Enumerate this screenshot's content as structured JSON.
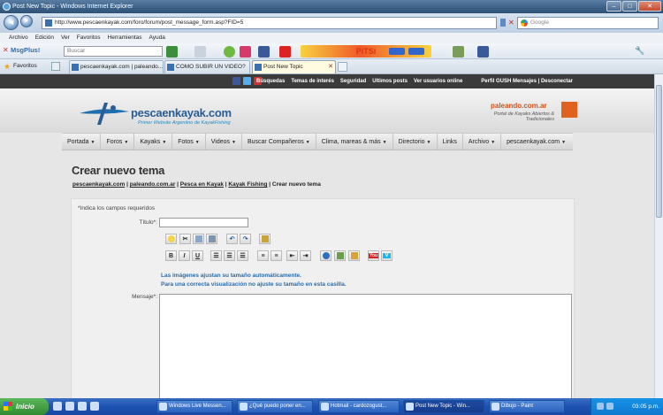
{
  "window": {
    "title": "Post New Topic - Windows Internet Explorer",
    "buttons": {
      "minimize": "–",
      "maximize": "□",
      "close": "✕"
    }
  },
  "browser": {
    "url": "http://www.pescaenkayak.com/foro/forum/post_message_form.asp?FID=5",
    "search_placeholder": "Google",
    "menu": [
      "Archivo",
      "Edición",
      "Ver",
      "Favoritos",
      "Herramientas",
      "Ayuda"
    ],
    "toolbar": {
      "msgplus_label": "MsgPlus!",
      "buscar_placeholder": "Buscar",
      "pitsi_label": "PiTSi"
    },
    "favorites_label": "Favoritos",
    "tabs": [
      {
        "label": "pescaenkayak.com | paleando...",
        "active": false
      },
      {
        "label": "COMO SUBIR UN VIDEO?",
        "active": false
      },
      {
        "label": "Post New Topic",
        "active": true
      }
    ]
  },
  "site": {
    "top_links": [
      "Búsquedas",
      "Temas de interés",
      "Seguridad",
      "Ultimos posts",
      "Ver usuarios online"
    ],
    "user_links": "Perfil GUSH  Mensajes  |  Desconectar",
    "logo_text": "pescaenkayak.com",
    "logo_tagline": "Primer Website Argentino de KayakFishing",
    "partner_name": "paleando.com.ar",
    "partner_tagline": "Portal de Kayaks Abiertos & Tradicionales",
    "nav": [
      {
        "label": "Portada",
        "dropdown": true
      },
      {
        "label": "Foros",
        "dropdown": true
      },
      {
        "label": "Kayaks",
        "dropdown": true
      },
      {
        "label": "Fotos",
        "dropdown": true
      },
      {
        "label": "Videos",
        "dropdown": true
      },
      {
        "label": "Buscar Compañeros",
        "dropdown": true
      },
      {
        "label": "Clima, mareas & más",
        "dropdown": true
      },
      {
        "label": "Directorio",
        "dropdown": true
      },
      {
        "label": "Links",
        "dropdown": false
      },
      {
        "label": "Archivo",
        "dropdown": true
      },
      {
        "label": "pescaenkayak.com",
        "dropdown": true
      }
    ]
  },
  "form": {
    "page_title": "Crear nuevo tema",
    "breadcrumb": {
      "link1": "pescaenkayak.com",
      "link2": "paleando.com.ar",
      "link3": "Pesca en Kayak",
      "link4": "Kayak Fishing",
      "current": "Crear nuevo tema",
      "sep": " | "
    },
    "required_note": "*Indica los campos requeridos",
    "title_label": "Título*:",
    "title_value": "",
    "message_label": "Mensaje*:",
    "message_value": "",
    "note_line1": "Las imágenes ajustan su tamaño automáticamente.",
    "note_line2": "Para una correcta visualización no ajuste su tamaño en esta casilla.",
    "editor_bold": "B",
    "editor_italic": "I",
    "editor_underline": "U",
    "youtube_label": "You",
    "vimeo_label": "V"
  },
  "taskbar": {
    "start_label": "Inicio",
    "tasks": [
      {
        "label": "Windows Live Messen...",
        "active": false
      },
      {
        "label": "¿Qué puedo poner en...",
        "active": false
      },
      {
        "label": "Hotmail - cardozogust...",
        "active": false
      },
      {
        "label": "Post New Topic - Win...",
        "active": true
      },
      {
        "label": "Dibujo - Paint",
        "active": false
      }
    ],
    "clock": "03:05 p.m."
  }
}
